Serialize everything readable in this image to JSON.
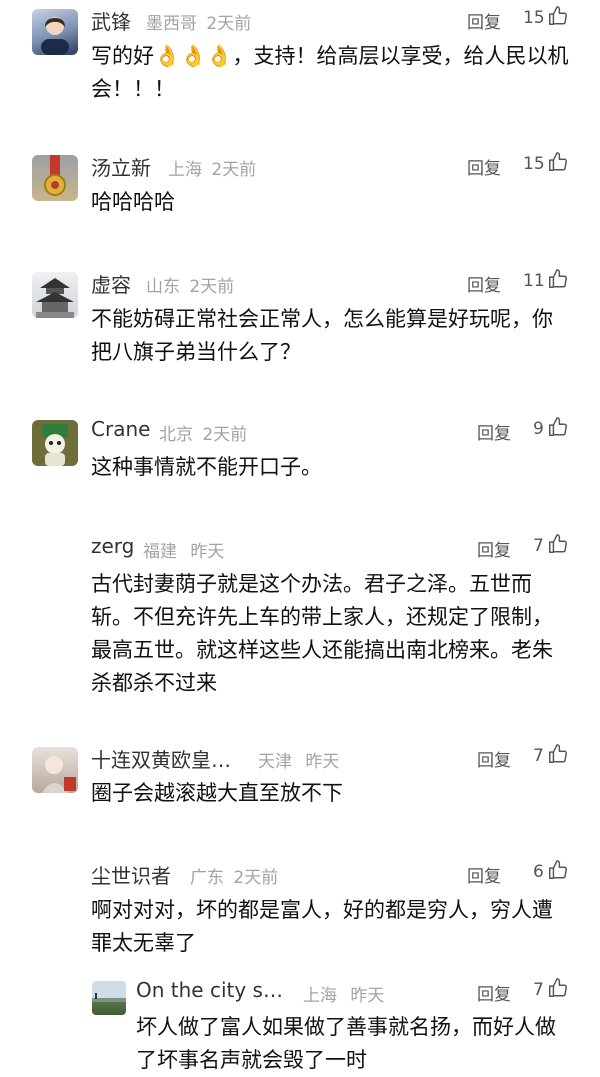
{
  "ui": {
    "reply_label": "回复"
  },
  "comments": [
    {
      "name": "武锋",
      "location": "墨西哥",
      "time": "2天前",
      "likes": "15",
      "text": "写的好👌👌👌，支持！给高层以享受，给人民以机会！！！"
    },
    {
      "name": "汤立新",
      "location": "上海",
      "time": "2天前",
      "likes": "15",
      "text": "哈哈哈哈"
    },
    {
      "name": "虚容",
      "location": "山东",
      "time": "2天前",
      "likes": "11",
      "text": "不能妨碍正常社会正常人，怎么能算是好玩呢，你把八旗子弟当什么了？"
    },
    {
      "name": "Crane",
      "location": "北京",
      "time": "2天前",
      "likes": "9",
      "text": "这种事情就不能开口子。"
    },
    {
      "name": "zerg",
      "location": "福建",
      "time": "昨天",
      "likes": "7",
      "text": "古代封妻荫子就是这个办法。君子之泽。五世而斩。不但充许先上车的带上家人，还规定了限制，最高五世。就这样这些人还能搞出南北榜来。老朱杀都杀不过来"
    },
    {
      "name": "十连双黄欧皇…",
      "location": "天津",
      "time": "昨天",
      "likes": "7",
      "text": "圈子会越滚越大直至放不下"
    },
    {
      "name": "尘世识者",
      "location": "广东",
      "time": "2天前",
      "likes": "6",
      "text": "啊对对对，坏的都是富人，好的都是穷人，穷人遭罪太无辜了"
    },
    {
      "name": "On the city s…",
      "location": "上海",
      "time": "昨天",
      "likes": "7",
      "text": "坏人做了富人如果做了善事就名扬，而好人做了坏事名声就会毁了一时"
    }
  ]
}
